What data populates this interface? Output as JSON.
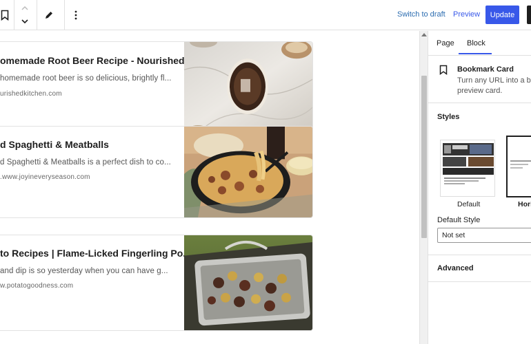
{
  "toolbar": {
    "switch_to_draft": "Switch to draft",
    "preview": "Preview",
    "update": "Update"
  },
  "cards": [
    {
      "title": "omemade Root Beer Recipe - Nourished K...",
      "description": "homemade root beer is so delicious, brightly fl...",
      "url": "urishedkitchen.com"
    },
    {
      "title": "d Spaghetti & Meatballs",
      "description": "d Spaghetti & Meatballs is a perfect dish to co...",
      "url": ".www.joyineveryseason.com"
    },
    {
      "title": "to Recipes | Flame-Licked Fingerling Po...",
      "description": " and dip is so yesterday when you can have g...",
      "url": "w.potatogoodness.com"
    }
  ],
  "sidebar": {
    "tabs": [
      "Page",
      "Block"
    ],
    "active_tab": "Block",
    "block_name": "Bookmark Card",
    "block_desc_line1": "Turn any URL into a beau",
    "block_desc_line2": "preview card.",
    "styles_heading": "Styles",
    "style_options": [
      "Default",
      "Hori"
    ],
    "default_style_label": "Default Style",
    "default_style_value": "Not set",
    "advanced_label": "Advanced"
  },
  "colors": {
    "accent": "#3858e9",
    "text": "#1e1e1e",
    "muted": "#555555"
  }
}
